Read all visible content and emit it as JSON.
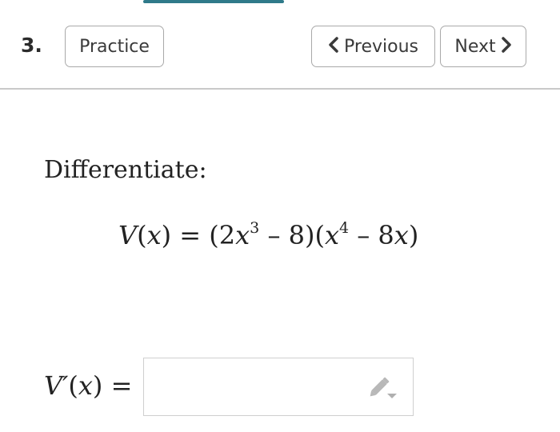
{
  "question": {
    "number": "3.",
    "practice_label": "Practice"
  },
  "navigation": {
    "previous_label": "Previous",
    "next_label": "Next",
    "previous_icon": "chevron-left-icon",
    "next_icon": "chevron-right-icon"
  },
  "problem": {
    "prompt": "Differentiate:",
    "function_name": "V",
    "variable": "x",
    "equals": "=",
    "factor1_coefficient": "2",
    "factor1_exponent": "3",
    "factor1_constant": "8",
    "factor2_exponent": "4",
    "factor2_coefficient": "8",
    "minus": "–"
  },
  "answer": {
    "label_function": "V′",
    "variable": "x",
    "equals": "=",
    "value": "",
    "editor_icon": "pencil-dropdown-icon"
  },
  "colors": {
    "accent": "#2f7a8a",
    "border": "#a9a9a9",
    "divider": "#c9c9c9",
    "icon_gray": "#b5b5b5"
  }
}
